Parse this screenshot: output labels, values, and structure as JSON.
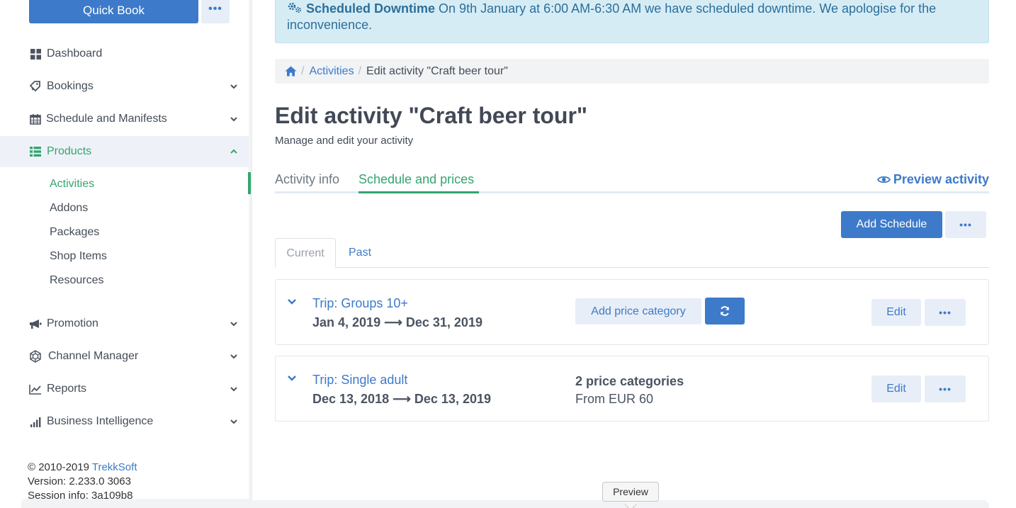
{
  "sidebar": {
    "quick_book_label": "Quick Book",
    "more_label": "•••",
    "items": [
      {
        "label": "Dashboard",
        "icon": "dashboard-icon"
      },
      {
        "label": "Bookings",
        "icon": "tag-icon"
      },
      {
        "label": "Schedule and Manifests",
        "icon": "calendar-icon"
      },
      {
        "label": "Products",
        "icon": "list-icon"
      },
      {
        "label": "Promotion",
        "icon": "megaphone-icon"
      },
      {
        "label": "Channel Manager",
        "icon": "network-icon"
      },
      {
        "label": "Reports",
        "icon": "line-chart-icon"
      },
      {
        "label": "Business Intelligence",
        "icon": "bar-chart-icon"
      }
    ],
    "sub_items": [
      {
        "label": "Activities"
      },
      {
        "label": "Addons"
      },
      {
        "label": "Packages"
      },
      {
        "label": "Shop Items"
      },
      {
        "label": "Resources"
      }
    ],
    "footer": {
      "copyright": "© 2010-2019 ",
      "brand": "TrekkSoft",
      "version": "Version: 2.233.0 3063",
      "session": "Session info: 3a109b8"
    }
  },
  "alert": {
    "title": "Scheduled Downtime",
    "message": " On 9th January at 6:00 AM-6:30 AM we have scheduled downtime. We apologise for the inconvenience."
  },
  "breadcrumb": {
    "separator": "/",
    "items": [
      "Activities",
      "Edit activity \"Craft beer tour\""
    ]
  },
  "page": {
    "title": "Edit activity \"Craft beer tour\"",
    "subtitle": "Manage and edit your activity"
  },
  "tabs": {
    "items": [
      "Activity info",
      "Schedule and prices"
    ],
    "preview_label": "Preview activity"
  },
  "toolbar": {
    "add_schedule_label": "Add Schedule",
    "more_label": "•••"
  },
  "subtabs": {
    "current": "Current",
    "past": "Past"
  },
  "schedules": [
    {
      "name": "Trip: Groups 10+",
      "dates": "Jan 4, 2019 ⟶ Dec 31, 2019",
      "add_price_label": "Add price category",
      "edit_label": "Edit",
      "more_label": "•••"
    },
    {
      "name": "Trip: Single adult",
      "dates": "Dec 13, 2018 ⟶ Dec 13, 2019",
      "price_count": "2 price categories",
      "price_from": "From EUR 60",
      "edit_label": "Edit",
      "more_label": "•••"
    }
  ],
  "tooltip": {
    "label": "Preview"
  },
  "colors": {
    "primary": "#3d7ac9",
    "accent_green": "#34a56f",
    "alert_bg": "#d6ecf5"
  }
}
